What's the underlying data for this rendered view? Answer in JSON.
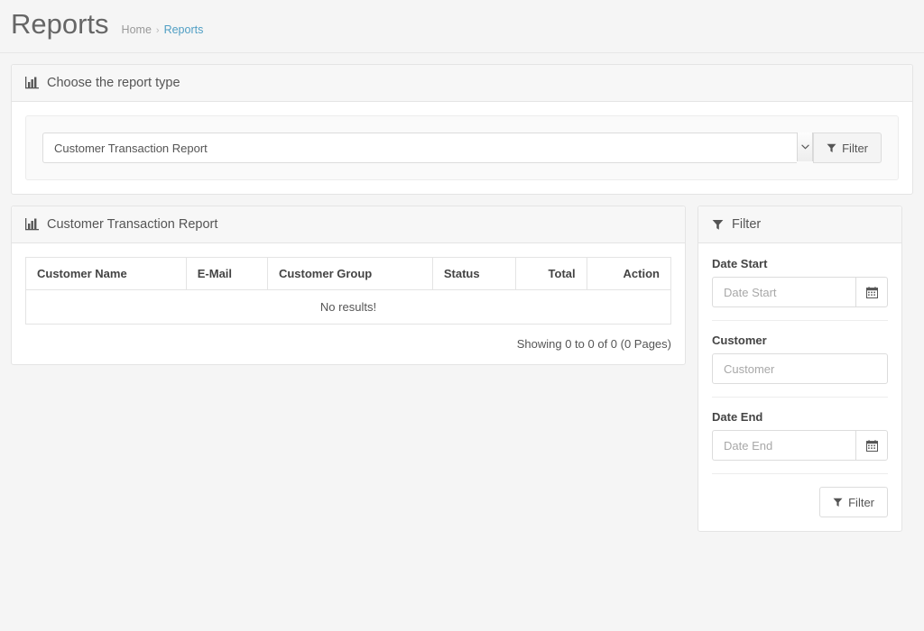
{
  "header": {
    "title": "Reports",
    "breadcrumb": {
      "home": "Home",
      "separator": "›",
      "current": "Reports"
    }
  },
  "report_type_panel": {
    "heading": "Choose the report type",
    "heading_icon": "bar-chart-icon",
    "select": {
      "selected_value": "Customer Transaction Report",
      "arrow_icon": "chevron-down-icon"
    },
    "filter_button": {
      "label": "Filter",
      "icon": "funnel-icon"
    }
  },
  "report_panel": {
    "heading": "Customer Transaction Report",
    "heading_icon": "bar-chart-icon",
    "table": {
      "columns": [
        {
          "label": "Customer Name",
          "align": "left"
        },
        {
          "label": "E-Mail",
          "align": "left"
        },
        {
          "label": "Customer Group",
          "align": "left"
        },
        {
          "label": "Status",
          "align": "left"
        },
        {
          "label": "Total",
          "align": "right"
        },
        {
          "label": "Action",
          "align": "right"
        }
      ],
      "empty_message": "No results!",
      "rows": []
    },
    "pagination_info": "Showing 0 to 0 of 0 (0 Pages)"
  },
  "filter_panel": {
    "heading": "Filter",
    "heading_icon": "funnel-icon",
    "fields": [
      {
        "label": "Date Start",
        "placeholder": "Date Start",
        "value": "",
        "addon_icon": "calendar-icon",
        "has_addon": true
      },
      {
        "label": "Customer",
        "placeholder": "Customer",
        "value": "",
        "addon_icon": "",
        "has_addon": false
      },
      {
        "label": "Date End",
        "placeholder": "Date End",
        "value": "",
        "addon_icon": "calendar-icon",
        "has_addon": true
      }
    ],
    "filter_button": {
      "label": "Filter",
      "icon": "funnel-icon"
    }
  },
  "colors": {
    "page_background": "#f5f5f5",
    "panel_background": "#ffffff",
    "panel_heading_background": "#f7f7f7",
    "border": "#e4e4e4",
    "link_accent": "#4f9ec4",
    "title_text": "#666666",
    "body_text": "#555555",
    "placeholder_text": "#a8a8a8"
  }
}
